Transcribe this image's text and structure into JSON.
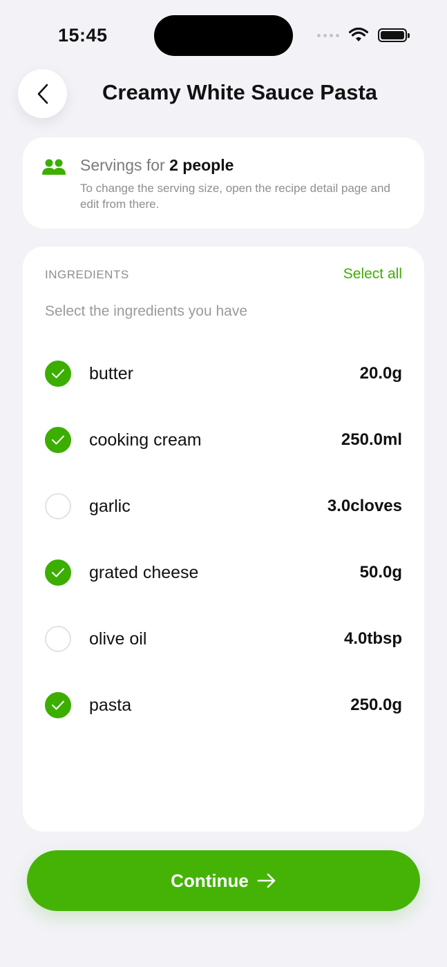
{
  "status_bar": {
    "time": "15:45"
  },
  "header": {
    "title": "Creamy White Sauce Pasta"
  },
  "servings": {
    "prefix": "Servings for",
    "count": "2 people",
    "hint": "To change the serving size, open the recipe detail page and edit from there."
  },
  "ingredients": {
    "section_label": "INGREDIENTS",
    "select_all": "Select all",
    "subtitle": "Select the ingredients you have",
    "items": [
      {
        "name": "butter",
        "qty": "20.0g",
        "checked": true
      },
      {
        "name": "cooking cream",
        "qty": "250.0ml",
        "checked": true
      },
      {
        "name": "garlic",
        "qty": "3.0cloves",
        "checked": false
      },
      {
        "name": "grated cheese",
        "qty": "50.0g",
        "checked": true
      },
      {
        "name": "olive oil",
        "qty": "4.0tbsp",
        "checked": false
      },
      {
        "name": "pasta",
        "qty": "250.0g",
        "checked": true
      }
    ]
  },
  "footer": {
    "continue_label": "Continue"
  },
  "colors": {
    "accent": "#44b306",
    "background": "#f2f2f7",
    "card": "#ffffff"
  },
  "icons": [
    "chevron-left-icon",
    "people-icon",
    "checkmark-icon",
    "arrow-right-icon",
    "wifi-icon",
    "battery-icon"
  ]
}
